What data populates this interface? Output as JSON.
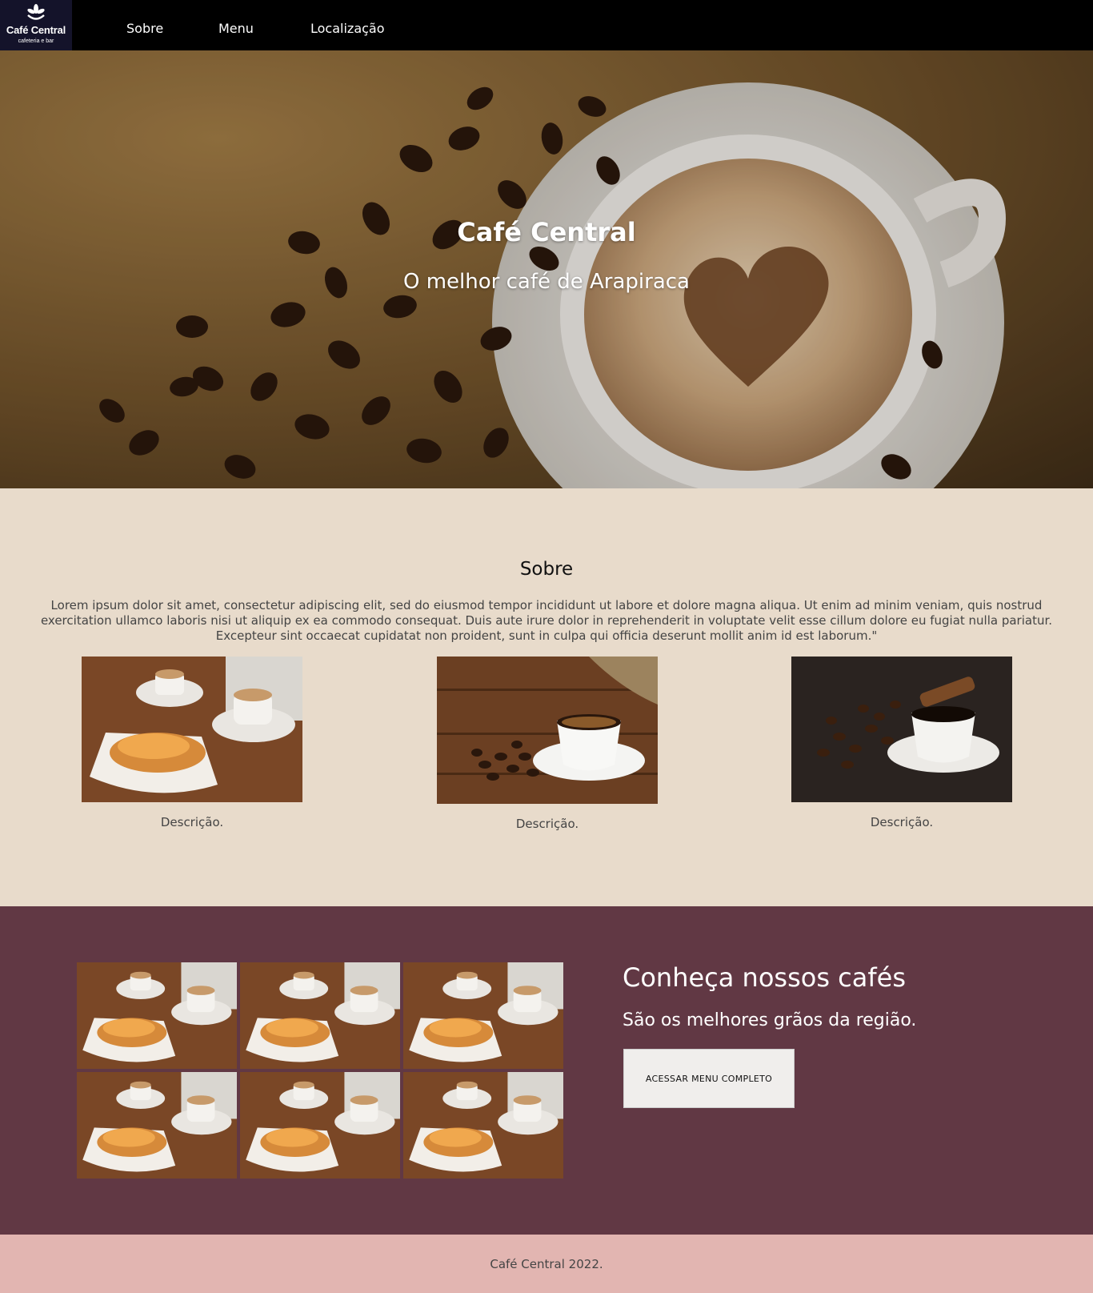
{
  "brand": {
    "name": "Café Central",
    "tagline": "cafeteria e bar"
  },
  "nav": {
    "items": [
      {
        "label": "Sobre"
      },
      {
        "label": "Menu"
      },
      {
        "label": "Localização"
      }
    ]
  },
  "hero": {
    "title": "Café Central",
    "subtitle": "O melhor café de Arapiraca"
  },
  "sobre": {
    "title": "Sobre",
    "text": "Lorem ipsum dolor sit amet, consectetur adipiscing elit, sed do eiusmod tempor incididunt ut labore et dolore magna aliqua. Ut enim ad minim veniam, quis nostrud exercitation ullamco laboris nisi ut aliquip ex ea commodo consequat. Duis aute irure dolor in reprehenderit in voluptate velit esse cillum dolore eu fugiat nulla pariatur. Excepteur sint occaecat cupidatat non proident, sunt in culpa qui officia deserunt mollit anim id est laborum.\"",
    "cards": [
      {
        "caption": "Descrição.",
        "image": "coffee-croissant-photo"
      },
      {
        "caption": "Descrição.",
        "image": "coffee-cup-beans-photo"
      },
      {
        "caption": "Descrição.",
        "image": "black-coffee-beans-photo"
      }
    ]
  },
  "cafes": {
    "title": "Conheça nossos cafés",
    "subtitle": "São os melhores grãos da região.",
    "button_label": "ACESSAR MENU COMPLETO",
    "gallery_count": 6
  },
  "footer": {
    "text": "Café Central 2022."
  },
  "colors": {
    "nav_bg": "#000000",
    "sobre_bg": "#e8dbcb",
    "cafes_bg": "#613844",
    "footer_bg": "#e2b5b1",
    "button_bg": "#f0eeec"
  }
}
